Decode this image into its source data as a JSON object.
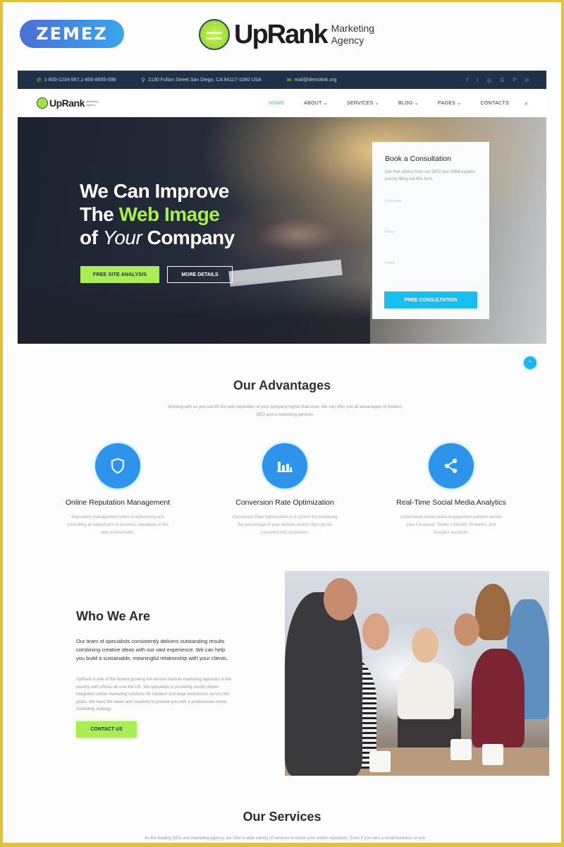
{
  "branding": {
    "vendor_logo": "ZEMEZ",
    "product_logo": "UpRank",
    "product_logo_sub": [
      "Marketing",
      "Agency"
    ]
  },
  "infobar": {
    "phone": "1-800-1234-567,1-800-8655-098",
    "address": "2130 Fulton Street San Diego, CA 94117-1080 USA",
    "email": "mail@demolink.org",
    "socials": [
      "f",
      "t",
      "◎",
      "G",
      "P",
      "in"
    ]
  },
  "nav": {
    "logo": "UpRank",
    "logo_sub": [
      "Marketing",
      "Agency"
    ],
    "items": [
      {
        "label": "HOME",
        "active": true
      },
      {
        "label": "ABOUT ⌄"
      },
      {
        "label": "SERVICES ⌄"
      },
      {
        "label": "BLOG ⌄"
      },
      {
        "label": "PAGES ⌄"
      },
      {
        "label": "CONTACTS"
      }
    ],
    "search_icon": "⌕"
  },
  "hero": {
    "line1": "We Can Improve",
    "line2_pre": "The ",
    "line2_accent": "Web Image",
    "line3_pre": "of ",
    "line3_italic": "Your",
    "line3_post": " Company",
    "primary_button": "FREE SITE ANALYSIS",
    "secondary_button": "MORE DETAILS"
  },
  "consultation": {
    "title": "Book a Consultation",
    "description": "Get free advice from our SEO and SMM experts just by filling out this form",
    "fields": [
      {
        "placeholder": "First name"
      },
      {
        "placeholder": "Phone"
      },
      {
        "placeholder": "E-Mail"
      }
    ],
    "submit": "FREE CONSULTATION"
  },
  "scroll_top": "⌃",
  "advantages": {
    "title": "Our Advantages",
    "subtitle": "Working with us you can lift the web reputation of your company higher than ever. We can offer you all advantages of modern SEO and e-marketing services",
    "features": [
      {
        "icon": "shield-icon",
        "title": "Online Reputation Management",
        "text": "Reputation management refers to influencing and controlling an individual's or business reputation in the web environment."
      },
      {
        "icon": "bar-chart-icon",
        "title": "Conversion Rate Optimization",
        "text": "Conversion Rate Optimization is a system for increasing the percentage of your website visitors that can be converted into customers."
      },
      {
        "icon": "share-icon",
        "title": "Real-Time Social Media Analytics",
        "text": "Understand social media engagement patterns across your Facebook, Twitter, LinkedIn, Pinterest, and Google+ accounts."
      }
    ]
  },
  "who": {
    "title": "Who We Are",
    "lead": "Our team of specialists consistently delivers outstanding results combining creative ideas with our vast experience. We can help you build a sustainable, meaningful relationship with your clients.",
    "body": "UpRank is one of the fastest growing full service Internet marketing agencies in the country with offices all over the US. We specialize in providing results driven integrated online marketing solutions for medium and large businesses across the globe. We have the talent and creativity to provide you with a professional online marketing strategy.",
    "button": "CONTACT US"
  },
  "services": {
    "title": "Our Services",
    "subtitle": "As the leading SEO and marketing agency, we offer a wide variety of services to boost your online reputation. Even if you own a small business or you are looking for additional promotion, we can help you."
  },
  "colors": {
    "accent_green": "#a9ee52",
    "accent_blue": "#18bdf2",
    "icon_blue": "#2e93ea",
    "infobar_bg": "#1f3048",
    "frame": "#e2c13d"
  }
}
